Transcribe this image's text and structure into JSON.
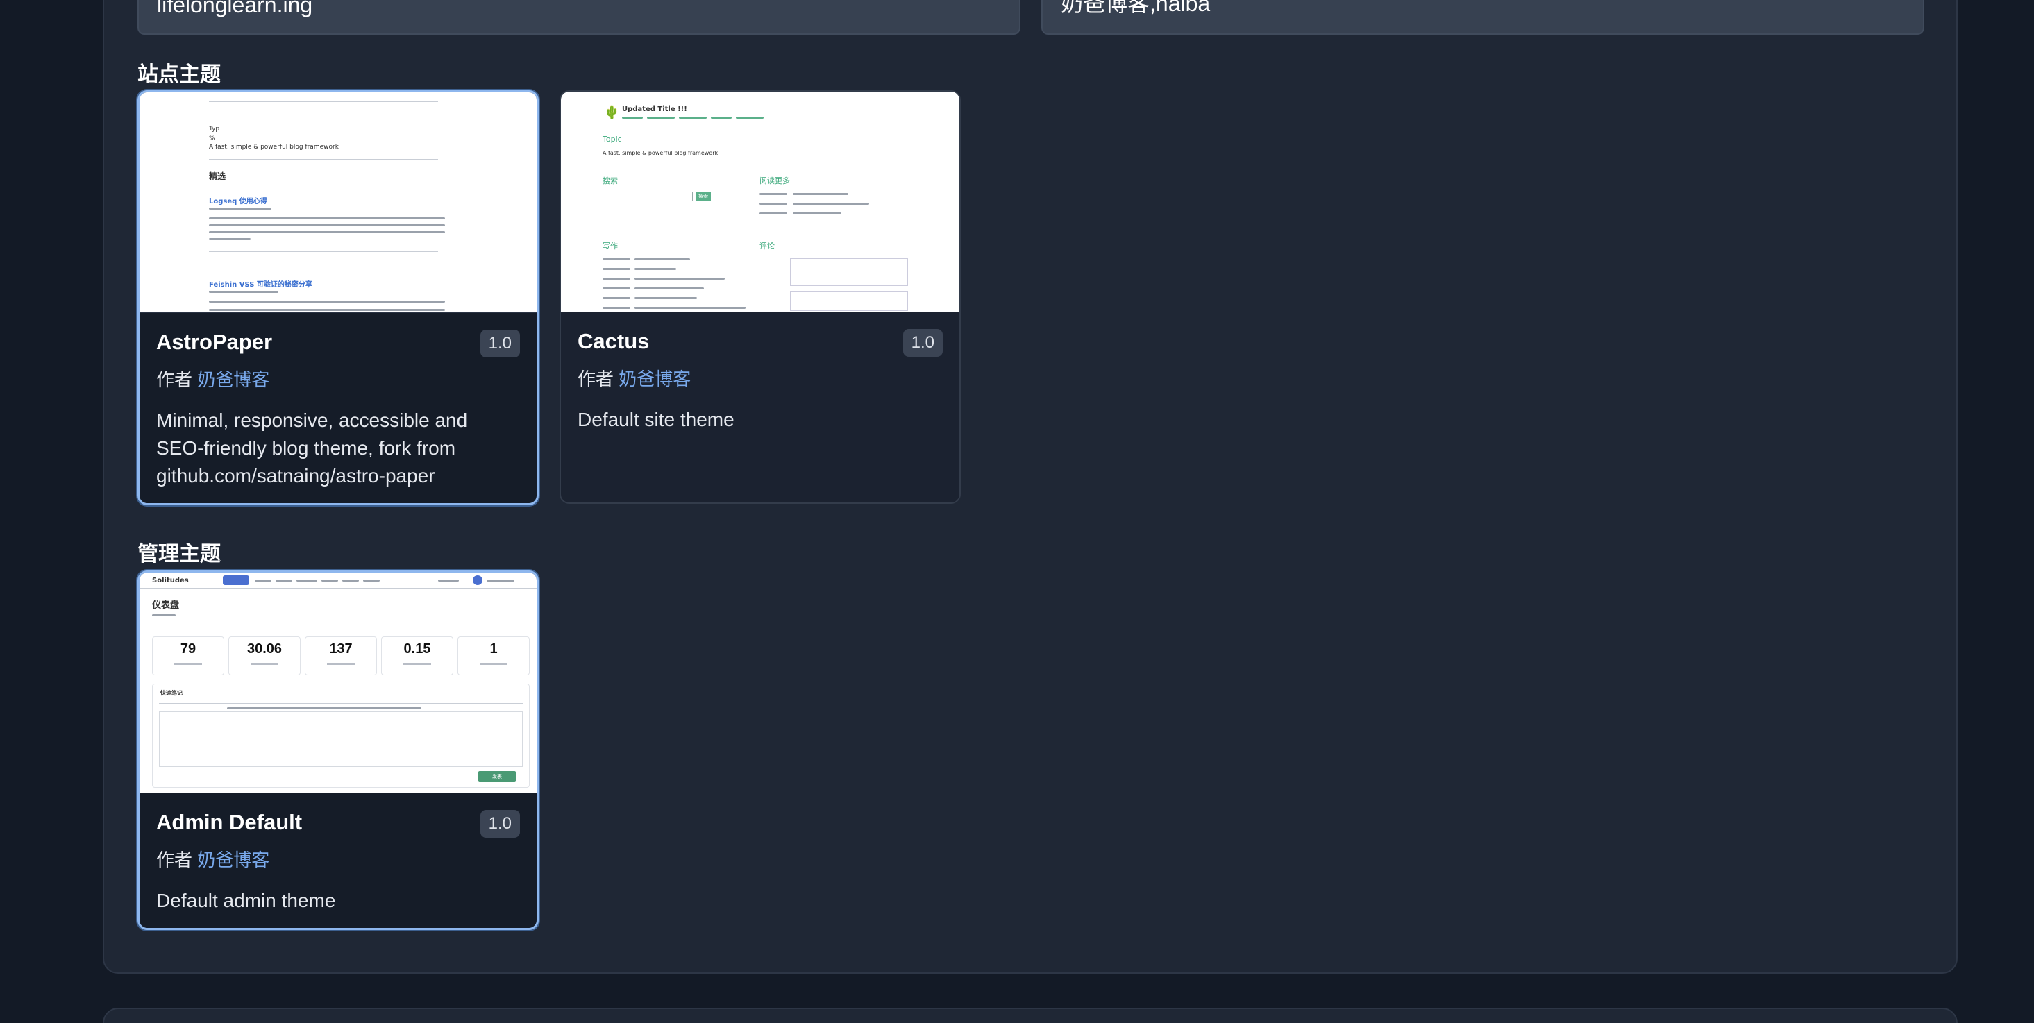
{
  "fields": {
    "site_url_value": "lifelonglearn.ing",
    "author_value": "奶爸博客,naiba"
  },
  "sections": {
    "site_theme_title": "站点主题",
    "admin_theme_title": "管理主题"
  },
  "site_themes": [
    {
      "name": "AstroPaper",
      "version": "1.0",
      "author_prefix": "作者",
      "author_name": "奶爸博客",
      "description": "Minimal, responsive, accessible and SEO-friendly blog theme, fork from github.com/satnaing/astro-paper",
      "selected": true,
      "preview": {
        "tagline": "A fast, simple & powerful blog framework",
        "heading": "精选",
        "post1_title": "Logseq 使用心得",
        "post2_title": "Feishin VSS 可验证的秘密分享",
        "top_text": "Typ"
      }
    },
    {
      "name": "Cactus",
      "version": "1.0",
      "author_prefix": "作者",
      "author_name": "奶爸博客",
      "description": "Default site theme",
      "selected": false,
      "preview": {
        "title": "Updated Title !!!",
        "section_topic": "Topic",
        "tagline": "A fast, simple & powerful blog framework",
        "search_label": "搜索",
        "search_button": "搜索",
        "read_more": "阅读更多",
        "writing": "写作",
        "comments": "评论"
      }
    }
  ],
  "admin_themes": [
    {
      "name": "Admin Default",
      "version": "1.0",
      "author_prefix": "作者",
      "author_name": "奶爸博客",
      "description": "Default admin theme",
      "selected": true,
      "preview": {
        "brand": "Solitudes",
        "dashboard_title": "仪表盘",
        "stats": [
          "79",
          "30.06",
          "137",
          "0.15",
          "1"
        ],
        "quick_note": "快速笔记",
        "publish_button": "发表"
      }
    }
  ]
}
